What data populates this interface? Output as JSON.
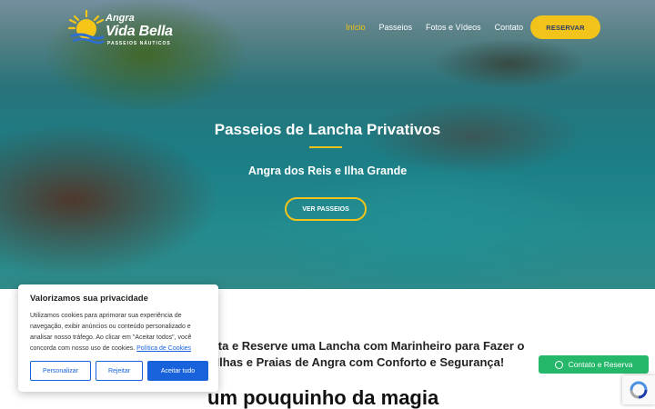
{
  "brand": {
    "line1": "Angra",
    "line2": "Vida Bella",
    "line3": "PASSEIOS NÁUTICOS"
  },
  "nav": [
    {
      "label": "Início",
      "active": true
    },
    {
      "label": "Passeios",
      "active": false
    },
    {
      "label": "Fotos e Vídeos",
      "active": false
    },
    {
      "label": "Contato",
      "active": false
    }
  ],
  "header": {
    "reserve_label": "RESERVAR"
  },
  "hero": {
    "title": "Passeios de Lancha Privativos",
    "subtitle": "Angra dos Reis e Ilha Grande",
    "cta_label": "VER PASSEIOS"
  },
  "intro": {
    "line1": "na a Data e Reserve uma Lancha com Marinheiro para Fazer o",
    "line2": "las Ilhas e Praias de Angra com Conforto e Segurança!"
  },
  "magic_heading": "um pouquinho da magia",
  "cookie": {
    "title": "Valorizamos sua privacidade",
    "text": "Utilizamos cookies para aprimorar sua experiência de navegação, exibir anúncios ou conteúdo personalizado e analisar nosso tráfego. Ao clicar em \"Aceitar todos\", você concorda com nosso uso de cookies.",
    "link": "Política de Cookies",
    "customize_label": "Personalizar",
    "reject_label": "Rejeitar",
    "accept_label": "Aceitar tudo"
  },
  "whatsapp": {
    "label": "Contato e Reserva",
    "icon": "whatsapp-icon"
  },
  "recaptcha": {
    "icon": "recaptcha-icon"
  },
  "colors": {
    "accent": "#f2c31b",
    "cookie_blue": "#1863dc",
    "whatsapp_green": "#25b86a"
  }
}
